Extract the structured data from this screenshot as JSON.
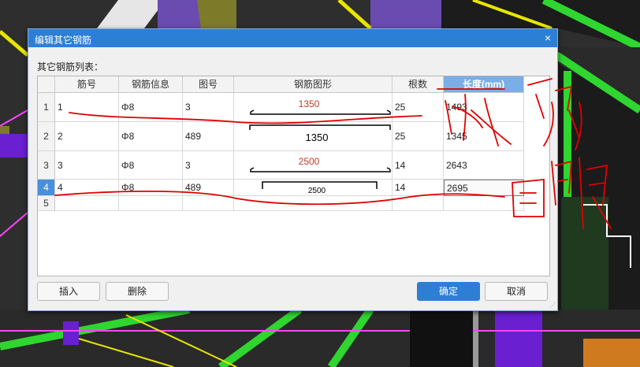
{
  "dialog": {
    "title": "编辑其它钢筋",
    "close_glyph": "×",
    "list_label": "其它钢筋列表："
  },
  "table": {
    "columns": [
      "筋号",
      "钢筋信息",
      "图号",
      "钢筋图形",
      "根数",
      "长度(mm)"
    ],
    "rows": [
      {
        "index": "1",
        "bar_no": "1",
        "bar_info": "Φ8",
        "shape_no": "3",
        "shape_label": "1350",
        "count": "25",
        "length": "1493"
      },
      {
        "index": "2",
        "bar_no": "2",
        "bar_info": "Φ8",
        "shape_no": "489",
        "shape_label": "1350",
        "count": "25",
        "length": "1345"
      },
      {
        "index": "3",
        "bar_no": "3",
        "bar_info": "Φ8",
        "shape_no": "3",
        "shape_label": "2500",
        "count": "14",
        "length": "2643"
      },
      {
        "index": "4",
        "bar_no": "4",
        "bar_info": "Φ8",
        "shape_no": "489",
        "shape_label": "2500",
        "count": "14",
        "length": "2695"
      },
      {
        "index": "5",
        "bar_no": "",
        "bar_info": "",
        "shape_no": "",
        "shape_label": "",
        "count": "",
        "length": ""
      }
    ],
    "selected_row": "4",
    "active_column": "长度(mm)"
  },
  "buttons": {
    "insert": "插入",
    "delete": "删除",
    "ok": "确定",
    "cancel": "取消"
  },
  "colors": {
    "title_bar": "#2d7fd6",
    "header_active": "#7aaee6",
    "dimension_text_red": "#c0392b",
    "annotation_red": "#e00000"
  }
}
